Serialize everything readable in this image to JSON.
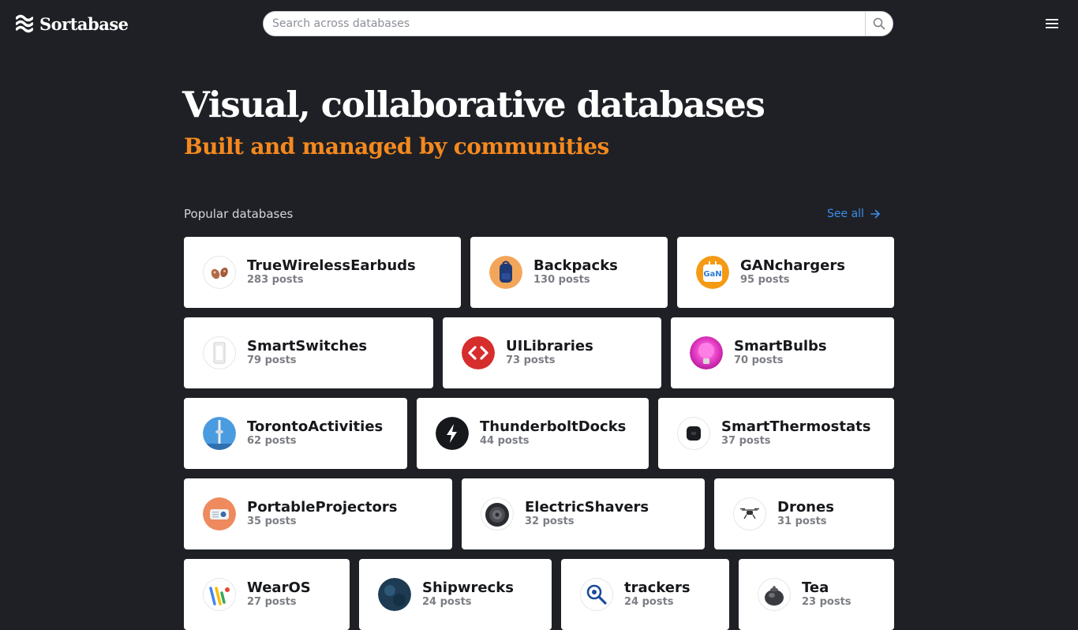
{
  "header": {
    "logo_text": "Sortabase",
    "search_placeholder": "Search across databases"
  },
  "hero": {
    "title": "Visual, collaborative databases",
    "subtitle": "Built and managed by communities"
  },
  "popular": {
    "label": "Popular databases",
    "see_all": "See all",
    "rows": [
      [
        {
          "name": "TrueWirelessEarbuds",
          "count": "283 posts",
          "icon": "earbuds-icon"
        },
        {
          "name": "Backpacks",
          "count": "130 posts",
          "icon": "backpack-icon"
        },
        {
          "name": "GANchargers",
          "count": "95 posts",
          "icon": "gan-charger-icon"
        }
      ],
      [
        {
          "name": "SmartSwitches",
          "count": "79 posts",
          "icon": "smart-switch-icon"
        },
        {
          "name": "UILibraries",
          "count": "73 posts",
          "icon": "code-icon"
        },
        {
          "name": "SmartBulbs",
          "count": "70 posts",
          "icon": "bulb-icon"
        }
      ],
      [
        {
          "name": "TorontoActivities",
          "count": "62 posts",
          "icon": "cn-tower-icon"
        },
        {
          "name": "ThunderboltDocks",
          "count": "44 posts",
          "icon": "thunderbolt-icon"
        },
        {
          "name": "SmartThermostats",
          "count": "37 posts",
          "icon": "thermostat-icon"
        }
      ],
      [
        {
          "name": "PortableProjectors",
          "count": "35 posts",
          "icon": "projector-icon"
        },
        {
          "name": "ElectricShavers",
          "count": "32 posts",
          "icon": "shaver-icon"
        },
        {
          "name": "Drones",
          "count": "31 posts",
          "icon": "drone-icon"
        }
      ],
      [
        {
          "name": "WearOS",
          "count": "27 posts",
          "icon": "wearos-icon"
        },
        {
          "name": "Shipwrecks",
          "count": "24 posts",
          "icon": "shipwreck-icon"
        },
        {
          "name": "trackers",
          "count": "24 posts",
          "icon": "tracker-icon"
        },
        {
          "name": "Tea",
          "count": "23 posts",
          "icon": "teapot-icon"
        }
      ]
    ]
  },
  "colors": {
    "background": "#1e2025",
    "accent_orange": "#f5891e",
    "link_blue": "#3b8eea",
    "card": "#ffffff"
  }
}
